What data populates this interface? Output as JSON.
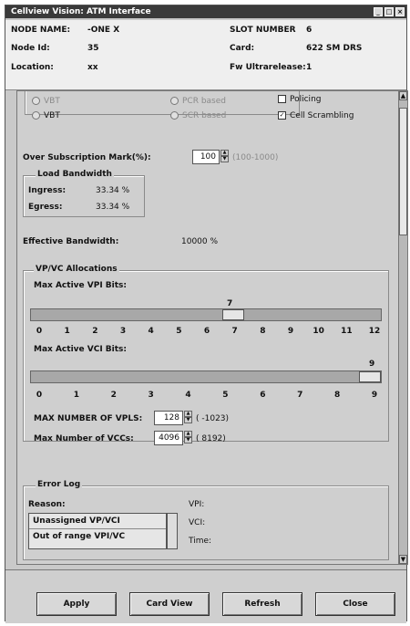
{
  "window": {
    "title": "Cellview Vision: ATM Interface"
  },
  "info": {
    "node_name_label": "NODE NAME:",
    "node_name_value": "-ONE X",
    "node_id_label": "Node Id:",
    "node_id_value": "35",
    "location_label": "Location:",
    "location_value": "xx",
    "slot_number_label": "SLOT NUMBER",
    "slot_number_value": "6",
    "card_label": "Card:",
    "card_value": "622 SM DRS",
    "fw_version_label": "Fw Ultrarelease:",
    "fw_version_value": "1"
  },
  "top_options": {
    "radio_1": "VBT",
    "radio_2": "VBT",
    "radio_3": "PCR based",
    "radio_4": "SCR based",
    "check_1": "Policing",
    "check_2": "Cell Scrambling"
  },
  "overbooking": {
    "label": "Over Subscription Mark(%):",
    "value": "100",
    "range": "(100-1000)"
  },
  "load_bandwidth": {
    "legend": "Load Bandwidth",
    "ingress_label": "Ingress:",
    "ingress_value": "33.34 %",
    "egress_label": "Egress:",
    "egress_value": "33.34 %"
  },
  "effective_bandwidth": {
    "label": "Effective Bandwidth:",
    "value": "10000 %"
  },
  "vpvc": {
    "legend": "VP/VC Allocations",
    "vpi_bits_label": "Max Active VPI Bits:",
    "vpi_bits_value": "7",
    "vpi_ticks": [
      "0",
      "1",
      "2",
      "3",
      "4",
      "5",
      "6",
      "7",
      "8",
      "9",
      "10",
      "11",
      "12"
    ],
    "vci_bits_label": "Max Active VCI Bits:",
    "vci_bits_value": "9",
    "vci_ticks": [
      "0",
      "1",
      "2",
      "3",
      "4",
      "5",
      "6",
      "7",
      "8",
      "9"
    ],
    "max_vpls_label": "MAX NUMBER OF VPLS:",
    "max_vpls_value": "128",
    "max_vpls_range": "( -1023)",
    "max_vccs_label": "Max Number of VCCs:",
    "max_vccs_value": "4096",
    "max_vccs_range": "( 8192)"
  },
  "error_log": {
    "legend": "Error Log",
    "reason_label": "Reason:",
    "item_1": "Unassigned VP/VCI",
    "item_2": "Out of range VPI/VC",
    "vpi_label": "VPI:",
    "vci_label": "VCI:",
    "time_label": "Time:"
  },
  "buttons": {
    "apply": "Apply",
    "card_view": "Card View",
    "refresh": "Refresh",
    "close": "Close"
  },
  "colors": {
    "title_bar": "#3a3a3a",
    "panel": "#cfcfcf",
    "info_bg": "#efefef"
  }
}
